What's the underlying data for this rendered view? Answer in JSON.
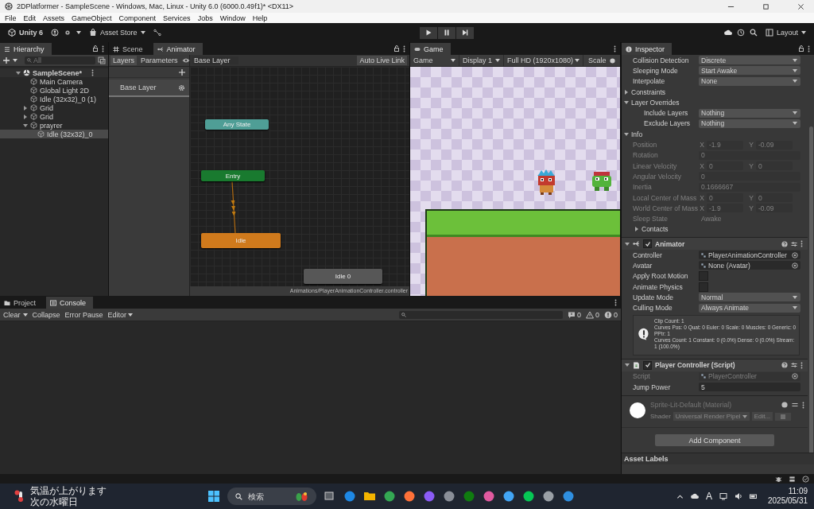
{
  "window": {
    "title": "2DPlatformer - SampleScene - Windows, Mac, Linux - Unity 6.0 (6000.0.49f1)* <DX11>"
  },
  "menu": [
    "File",
    "Edit",
    "Assets",
    "GameObject",
    "Component",
    "Services",
    "Jobs",
    "Window",
    "Help"
  ],
  "toolbar": {
    "product": "Unity 6",
    "asset_store": "Asset Store",
    "layout": "Layout"
  },
  "hierarchy": {
    "tab": "Hierarchy",
    "search_placeholder": "All",
    "tree": [
      {
        "label": "SampleScene*",
        "kind": "scene",
        "expanded": true,
        "selected": false,
        "children": [
          {
            "label": "Main Camera",
            "kind": "object",
            "selected": false
          },
          {
            "label": "Global Light 2D",
            "kind": "object",
            "selected": false
          },
          {
            "label": "Idle (32x32)_0 (1)",
            "kind": "object",
            "selected": false
          },
          {
            "label": "Grid",
            "kind": "object",
            "expanded": false,
            "selected": false
          },
          {
            "label": "Grid",
            "kind": "object",
            "expanded": false,
            "selected": false
          },
          {
            "label": "prayrer",
            "kind": "object",
            "expanded": true,
            "selected": false,
            "children": [
              {
                "label": "Idle (32x32)_0",
                "kind": "object",
                "selected": true
              }
            ]
          }
        ]
      }
    ]
  },
  "center_tabs": [
    {
      "label": "Scene",
      "kind": "scene",
      "selected": false
    },
    {
      "label": "Animator",
      "kind": "animator",
      "selected": true
    }
  ],
  "animator": {
    "modes": [
      {
        "label": "Layers",
        "selected": true
      },
      {
        "label": "Parameters",
        "selected": false
      }
    ],
    "breadcrumb": "Base Layer",
    "live_link": "Auto Live Link",
    "layers": [
      {
        "name": "Base Layer"
      }
    ],
    "states": [
      {
        "name": "Any State",
        "color": "#4f9e96"
      },
      {
        "name": "Entry",
        "color": "#197a2f"
      },
      {
        "name": "Idle",
        "color": "#d07a1c"
      },
      {
        "name": "Idle 0",
        "color": "#575757"
      }
    ],
    "path": "Animations/PlayerAnimationController.controller"
  },
  "game": {
    "tab": "Game",
    "dropdowns": [
      "Game",
      "Display 1",
      "Full HD (1920x1080)"
    ],
    "scale": "Scale"
  },
  "inspector": {
    "tab": "Inspector",
    "rigidbody_rows": [
      {
        "kind": "dropdown",
        "label": "Collision Detection",
        "value": "Discrete",
        "disabled": false
      },
      {
        "kind": "dropdown",
        "label": "Sleeping Mode",
        "value": "Start Awake",
        "disabled": false
      },
      {
        "kind": "dropdown",
        "label": "Interpolate",
        "value": "None",
        "disabled": false
      },
      {
        "kind": "foldout",
        "label": "Constraints",
        "expanded": false,
        "disabled": false
      },
      {
        "kind": "foldout",
        "label": "Layer Overrides",
        "expanded": true,
        "disabled": false,
        "children": [
          {
            "kind": "dropdown",
            "label": "Include Layers",
            "value": "Nothing",
            "disabled": false
          },
          {
            "kind": "dropdown",
            "label": "Exclude Layers",
            "value": "Nothing",
            "disabled": false
          }
        ]
      },
      {
        "kind": "foldout",
        "label": "Info",
        "expanded": true,
        "disabled": false,
        "children": [
          {
            "kind": "vector",
            "label": "Position",
            "values": [
              {
                "axis": "X",
                "value": "-1.9"
              },
              {
                "axis": "Y",
                "value": "-0.09"
              }
            ],
            "disabled": true
          },
          {
            "kind": "field",
            "label": "Rotation",
            "value": "0",
            "disabled": true
          },
          {
            "kind": "vector",
            "label": "Linear Velocity",
            "values": [
              {
                "axis": "X",
                "value": "0"
              },
              {
                "axis": "Y",
                "value": "0"
              }
            ],
            "disabled": true
          },
          {
            "kind": "field",
            "label": "Angular Velocity",
            "value": "0",
            "disabled": true
          },
          {
            "kind": "field",
            "label": "Inertia",
            "value": "0.1666667",
            "disabled": true
          },
          {
            "kind": "vector",
            "label": "Local Center of Mass",
            "values": [
              {
                "axis": "X",
                "value": "0"
              },
              {
                "axis": "Y",
                "value": "0"
              }
            ],
            "disabled": true
          },
          {
            "kind": "vector",
            "label": "World Center of Mass",
            "values": [
              {
                "axis": "X",
                "value": "-1.9"
              },
              {
                "axis": "Y",
                "value": "-0.09"
              }
            ],
            "disabled": true
          },
          {
            "kind": "text",
            "label": "Sleep State",
            "value": "Awake",
            "disabled": true
          },
          {
            "kind": "foldout",
            "label": "Contacts",
            "expanded": false,
            "disabled": false
          }
        ]
      }
    ],
    "components": [
      {
        "kind": "animator",
        "title": "Animator",
        "checked": true,
        "rows": [
          {
            "kind": "object",
            "label": "Controller",
            "value": "PlayerAnimationController",
            "disabled": false
          },
          {
            "kind": "object",
            "label": "Avatar",
            "value": "None (Avatar)",
            "disabled": false
          },
          {
            "kind": "checkbox",
            "label": "Apply Root Motion",
            "checked": false,
            "disabled": false
          },
          {
            "kind": "checkbox",
            "label": "Animate Physics",
            "checked": false,
            "disabled": false
          },
          {
            "kind": "dropdown",
            "label": "Update Mode",
            "value": "Normal",
            "disabled": false
          },
          {
            "kind": "dropdown",
            "label": "Culling Mode",
            "value": "Always Animate",
            "disabled": false
          }
        ],
        "info": [
          "Clip Count: 1",
          "Curves Pos: 0 Quat: 0 Euler: 0 Scale: 0 Muscles: 0 Generic: 0 PPtr: 1",
          "Curves Count: 1 Constant: 0 (0.0%) Dense: 0 (0.0%) Stream: 1 (100.0%)"
        ]
      },
      {
        "kind": "script",
        "title": "Player Controller (Script)",
        "checked": true,
        "rows": [
          {
            "kind": "object",
            "label": "Script",
            "value": "PlayerController",
            "disabled": true
          },
          {
            "kind": "field",
            "label": "Jump Power",
            "value": "5",
            "disabled": false
          }
        ]
      },
      {
        "kind": "material",
        "title": "Sprite-Lit-Default (Material)",
        "shader_label": "Shader",
        "shader": "Universal Render Pipel",
        "edit": "Edit..."
      }
    ],
    "add_component": "Add Component",
    "asset_labels": "Asset Labels"
  },
  "console": {
    "tabs": [
      {
        "label": "Project",
        "kind": "project",
        "selected": false
      },
      {
        "label": "Console",
        "kind": "console",
        "selected": true
      }
    ],
    "buttons": [
      "Clear",
      "Collapse",
      "Error Pause",
      "Editor"
    ],
    "counts": [
      {
        "kind": "info",
        "count": "0"
      },
      {
        "kind": "warning",
        "count": "0"
      },
      {
        "kind": "error",
        "count": "0"
      }
    ]
  },
  "taskbar": {
    "weather_title": "気温が上がります",
    "weather_subtitle": "次の水曜日",
    "search_placeholder": "検索",
    "ime": "A",
    "time": "11:09",
    "date": "2025/05/31"
  }
}
